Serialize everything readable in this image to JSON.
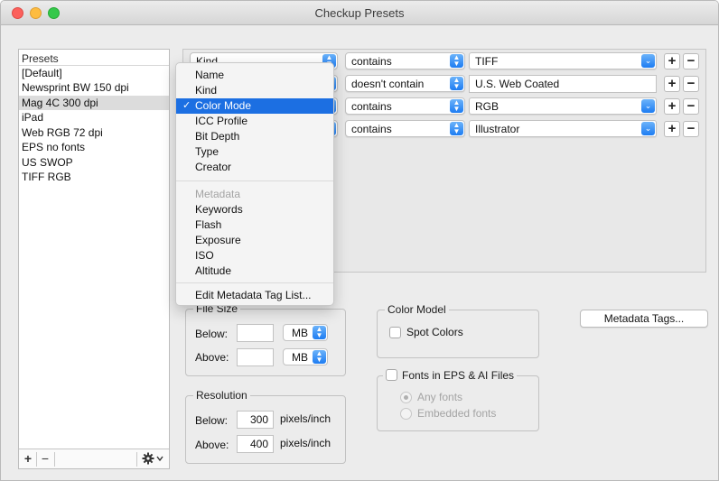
{
  "window": {
    "title": "Checkup Presets"
  },
  "presets": {
    "header": "Presets",
    "items": [
      "[Default]",
      "Newsprint BW 150 dpi",
      "Mag 4C 300 dpi",
      "iPad",
      "Web RGB 72 dpi",
      "EPS no fonts",
      "US SWOP",
      "TIFF RGB"
    ],
    "selected": "Mag 4C 300 dpi",
    "toolbar": {
      "add": "+",
      "remove": "−",
      "action_icon": "gear-icon"
    }
  },
  "rules": [
    {
      "attribute": "Kind",
      "operator": "contains",
      "value": "TIFF",
      "value_kind": "combo",
      "add": "+",
      "remove": "−"
    },
    {
      "attribute": "",
      "operator": "doesn't contain",
      "value": "U.S. Web Coated",
      "value_kind": "text",
      "add": "+",
      "remove": "−"
    },
    {
      "attribute": "",
      "operator": "contains",
      "value": "RGB",
      "value_kind": "combo",
      "add": "+",
      "remove": "−"
    },
    {
      "attribute": "",
      "operator": "contains",
      "value": "Illustrator",
      "value_kind": "combo",
      "add": "+",
      "remove": "−"
    }
  ],
  "menu": {
    "items_group1": [
      "Name",
      "Kind",
      "Color Mode",
      "ICC Profile",
      "Bit Depth",
      "Type",
      "Creator"
    ],
    "checked": "Color Mode",
    "check_mark": "✓",
    "metadata_header": "Metadata",
    "items_group2": [
      "Keywords",
      "Flash",
      "Exposure",
      "ISO",
      "Altitude"
    ],
    "edit_item": "Edit Metadata Tag List..."
  },
  "file_size": {
    "title": "File Size",
    "below_label": "Below:",
    "below_value": "",
    "below_unit": "MB",
    "above_label": "Above:",
    "above_value": "",
    "above_unit": "MB"
  },
  "resolution": {
    "title": "Resolution",
    "below_label": "Below:",
    "below_value": "300",
    "below_unit": "pixels/inch",
    "above_label": "Above:",
    "above_value": "400",
    "above_unit": "pixels/inch"
  },
  "color_model": {
    "title": "Color Model",
    "spot_colors_label": "Spot Colors",
    "spot_colors_checked": false
  },
  "fonts": {
    "title": "Fonts in EPS & AI Files",
    "checked": false,
    "any_fonts": "Any fonts",
    "embedded_fonts": "Embedded fonts",
    "selected_option": "Any fonts"
  },
  "metadata_tags_button": "Metadata Tags...",
  "colors": {
    "accent": "#1c6fe2",
    "stepper": "#1d7cf2",
    "close": "#fc605c",
    "minimize": "#fdbc40",
    "zoom": "#34c84a"
  }
}
